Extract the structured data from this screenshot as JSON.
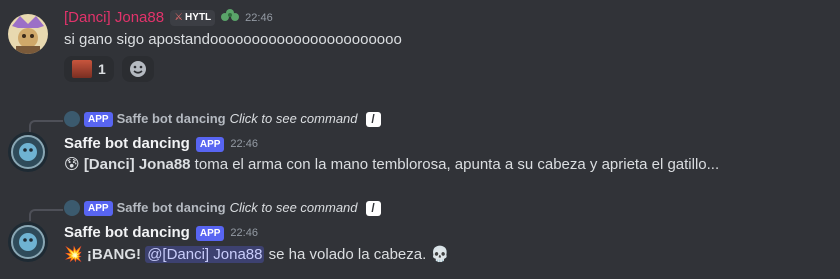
{
  "messages": [
    {
      "author": "[Danci] Jona88",
      "author_color": "#e2336b",
      "server_tag": "HYTL",
      "timestamp": "22:46",
      "text": "si gano sigo apostandooooooooooooooooooooooo",
      "reaction_count": "1"
    },
    {
      "reply": {
        "author": "Saffe bot dancing",
        "command_text": "Click to see command"
      },
      "author": "Saffe bot dancing",
      "badge": "APP",
      "timestamp": "22:46",
      "emoji": "😰",
      "bold_text": "[Danci] Jona88",
      "text": " toma el arma con la mano temblorosa, apunta a su cabeza y aprieta el gatillo..."
    },
    {
      "reply": {
        "author": "Saffe bot dancing",
        "command_text": "Click to see command"
      },
      "author": "Saffe bot dancing",
      "badge": "APP",
      "timestamp": "22:46",
      "emoji": "💥",
      "bold_text": "¡BANG!",
      "mention": "@[Danci] Jona88",
      "text": " se ha volado la cabeza.",
      "trailing_emoji": "💀"
    }
  ]
}
